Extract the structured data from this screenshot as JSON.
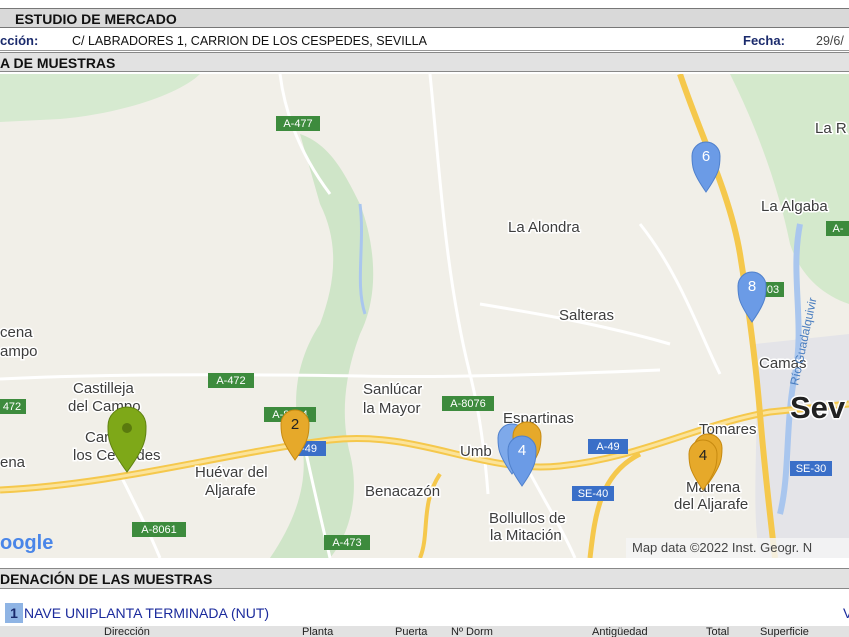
{
  "header": {
    "title": "ESTUDIO DE MERCADO",
    "address_label": "cción:",
    "address_value": "C/ LABRADORES 1, CARRION DE LOS CESPEDES, SEVILLA",
    "date_label": "Fecha:",
    "date_value": "29/6/"
  },
  "map_section": {
    "title": "A DE MUESTRAS",
    "attribution": "Map data ©2022 Inst. Geogr. N",
    "logo": "oogle",
    "places": {
      "la_alondra": "La Alondra",
      "la_algaba": "La Algaba",
      "la_r": "La R",
      "salteras": "Salteras",
      "camas": "Camas",
      "sevilla": "Sev",
      "tomares": "Tomares",
      "mairena1": "Mairena",
      "mairena2": "del Aljarafe",
      "espartinas": "Espartinas",
      "umbrete": "Umb",
      "sanlucar1": "Sanlúcar",
      "sanlucar2": "la Mayor",
      "benacazon": "Benacazón",
      "bollullos1": "Bollullos de",
      "bollullos2": "la Mitación",
      "huevar1": "Huévar del",
      "huevar2": "Aljarafe",
      "castilleja1": "Castilleja",
      "castilleja2": "del Campo",
      "carrion1": "Car   n de",
      "carrion2": "los Ce   pedes",
      "cena1": "cena",
      "cena2": "ampo",
      "ena": "ena",
      "rio": "Río Guadalquivir"
    },
    "roads": {
      "a477": "A-477",
      "a472": "A-472",
      "a472b": "472",
      "a8076": "A-8076",
      "a49a": "A-49",
      "a49b": "-49",
      "a8064": "A-8064",
      "a8061": "A-8061",
      "a473": "A-473",
      "se40": "SE-40",
      "se30": "SE-30",
      "r03": "03",
      "a8": "A-"
    },
    "markers": [
      {
        "label": "6",
        "color": "#6b9be6"
      },
      {
        "label": "8",
        "color": "#6b9be6"
      },
      {
        "label": "4",
        "color": "#6b9be6"
      },
      {
        "label": "2",
        "color": "#e6a92a"
      },
      {
        "label": "4",
        "color": "#e6a92a"
      },
      {
        "label": "",
        "color": "#7ea818"
      }
    ]
  },
  "order_section": {
    "title": "DENACIÓN DE LAS MUESTRAS",
    "item_number": "1",
    "item_text": "NAVE UNIPLANTA TERMINADA (NUT)",
    "item_right": "V",
    "columns": [
      "Dirección",
      "Planta",
      "Puerta",
      "Nº Dorm",
      "Antigüedad",
      "Total",
      "Superficie"
    ]
  }
}
